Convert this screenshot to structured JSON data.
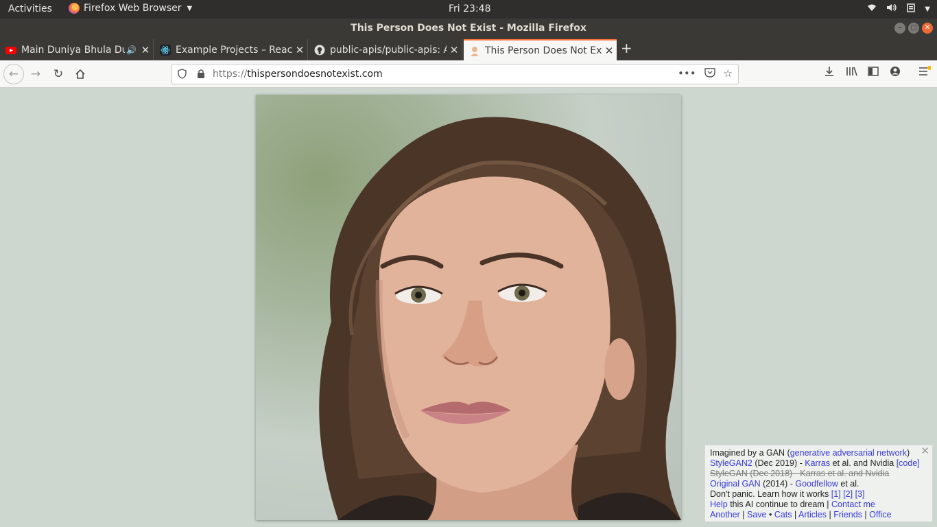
{
  "topbar": {
    "activities": "Activities",
    "app_name": "Firefox Web Browser",
    "clock": "Fri 23:48"
  },
  "window": {
    "title": "This Person Does Not Exist - Mozilla Firefox"
  },
  "tabs": [
    {
      "label": "Main Duniya Bhula Du",
      "favicon": "youtube-icon",
      "audio": true,
      "active": false
    },
    {
      "label": "Example Projects – React",
      "favicon": "react-icon",
      "audio": false,
      "active": false
    },
    {
      "label": "public-apis/public-apis: A",
      "favicon": "github-icon",
      "audio": false,
      "active": false
    },
    {
      "label": "This Person Does Not Exist",
      "favicon": "person-icon",
      "audio": false,
      "active": true
    }
  ],
  "toolbar": {
    "url_scheme": "https://",
    "url_host": "thispersondoesnotexist.com"
  },
  "infobox": {
    "l1_text": "Imagined by a GAN (",
    "l1_link": "generative adversarial network",
    "l1_end": ")",
    "l2_link1": "StyleGAN2",
    "l2_text1": " (Dec 2019) - ",
    "l2_link2": "Karras",
    "l2_text2": " et al. and Nvidia ",
    "l2_link3": "[code]",
    "l3_strike": "StyleGAN (Dec 2018) - Karras et al. and Nvidia",
    "l4_link1": "Original GAN",
    "l4_text1": " (2014) - ",
    "l4_link2": "Goodfellow",
    "l4_text2": " et al.",
    "l5_text": "Don't panic. Learn how it works ",
    "l5_ref1": "[1]",
    "l5_ref2": "[2]",
    "l5_ref3": "[3]",
    "l6_link1": "Help",
    "l6_text": " this AI continue to dream | ",
    "l6_link2": "Contact me",
    "l7_another": "Another",
    "l7_save": "Save",
    "l7_cats": "Cats",
    "l7_articles": "Articles",
    "l7_friends": "Friends",
    "l7_office": "Office"
  },
  "colors": {
    "page_bg": "#cdd7cf",
    "link": "#3a3ad8",
    "active_tab_accent": "#ff7139"
  }
}
